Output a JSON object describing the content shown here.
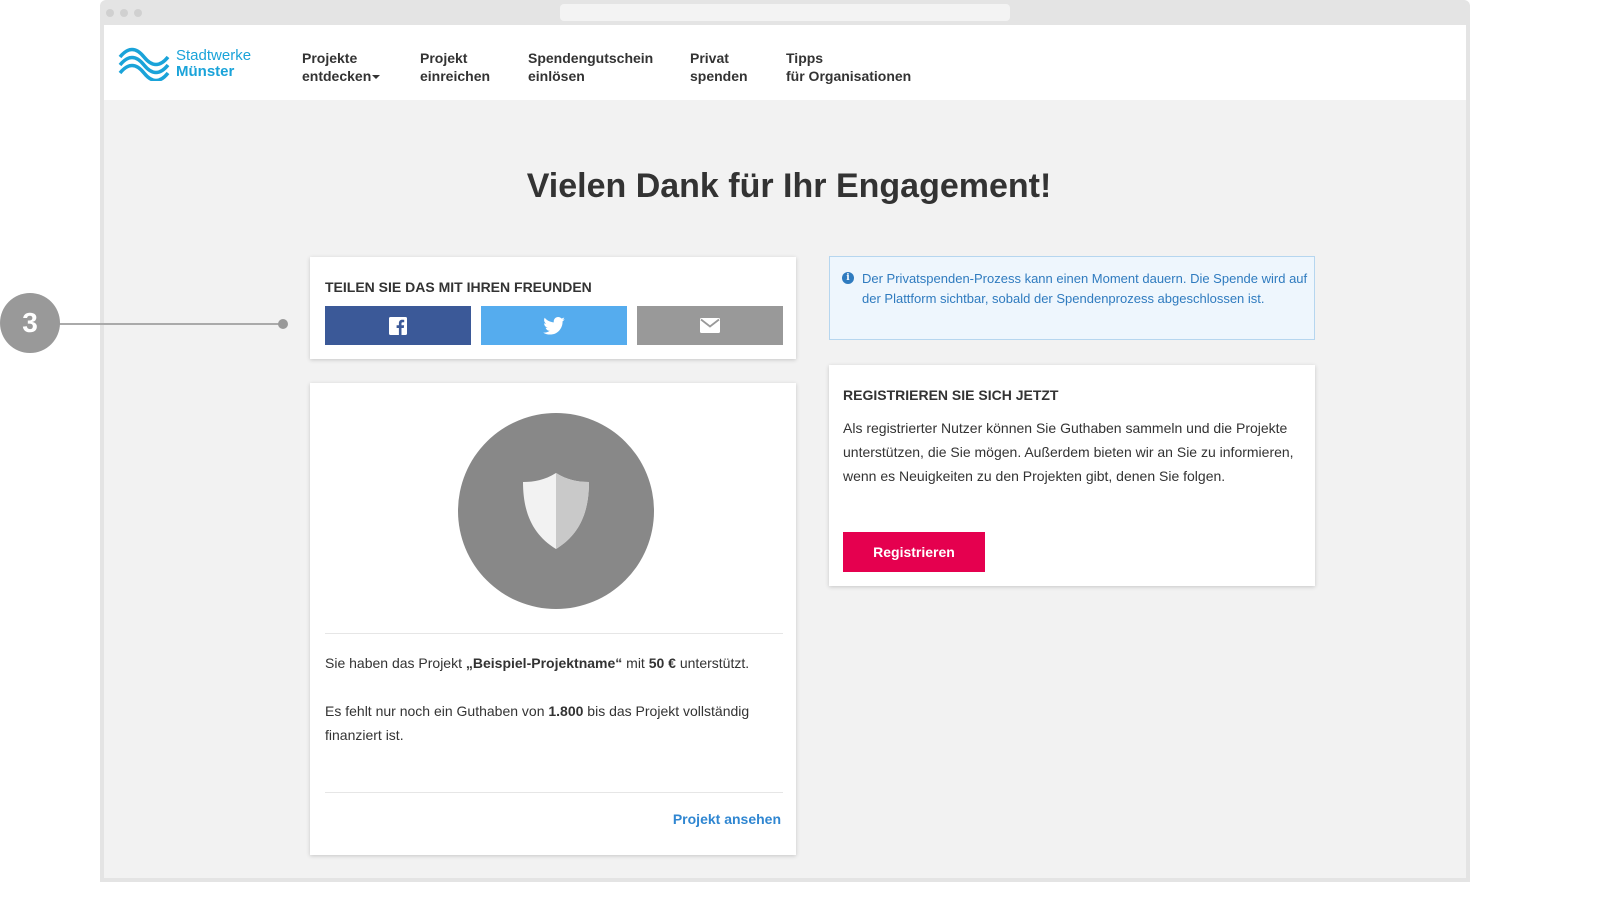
{
  "brand": {
    "line1": "Stadtwerke",
    "line2": "Münster",
    "color": "#1aa3d9"
  },
  "nav": {
    "item1": {
      "line1": "Projekte",
      "line2": "entdecken"
    },
    "item2": {
      "line1": "Projekt",
      "line2": "einreichen"
    },
    "item3": {
      "line1": "Spendengutschein",
      "line2": "einlösen"
    },
    "item4": {
      "line1": "Privat",
      "line2": "spenden"
    },
    "item5": {
      "line1": "Tipps",
      "line2": "für Organisationen"
    }
  },
  "page": {
    "title": "Vielen Dank für Ihr Engagement!"
  },
  "share": {
    "title": "TEILEN SIE DAS MIT IHREN FREUNDEN",
    "buttons": [
      {
        "icon": "facebook-icon",
        "color": "#3b5998"
      },
      {
        "icon": "twitter-icon",
        "color": "#55acee"
      },
      {
        "icon": "envelope-icon",
        "color": "#999999"
      }
    ]
  },
  "project": {
    "icon": "shield-icon",
    "line1_pre": "Sie haben das Projekt ",
    "project_name": "„Beispiel-Projektname“",
    "line1_mid": " mit ",
    "amount": "50 €",
    "line1_post": " unterstützt.",
    "line2_pre": "Es fehlt nur noch ein Guthaben von ",
    "remaining": "1.800",
    "line2_post": " bis das Projekt vollständig finanziert ist.",
    "link": "Projekt ansehen"
  },
  "info": {
    "icon": "info-icon",
    "text": "Der Privatspenden-Prozess kann einen Moment dauern. Die Spende wird auf der Plattform sichtbar, sobald der Spendenprozess abgeschlossen ist."
  },
  "register": {
    "title": "REGISTRIEREN SIE SICH JETZT",
    "text": "Als registrierter Nutzer können Sie Guthaben sammeln und die Projekte unterstützen, die Sie mögen. Außerdem bieten wir an Sie zu informieren, wenn es Neuigkeiten zu den Projekten gibt, denen Sie folgen.",
    "button": "Registrieren",
    "button_color": "#e5004f"
  },
  "callout": {
    "number": "3"
  }
}
